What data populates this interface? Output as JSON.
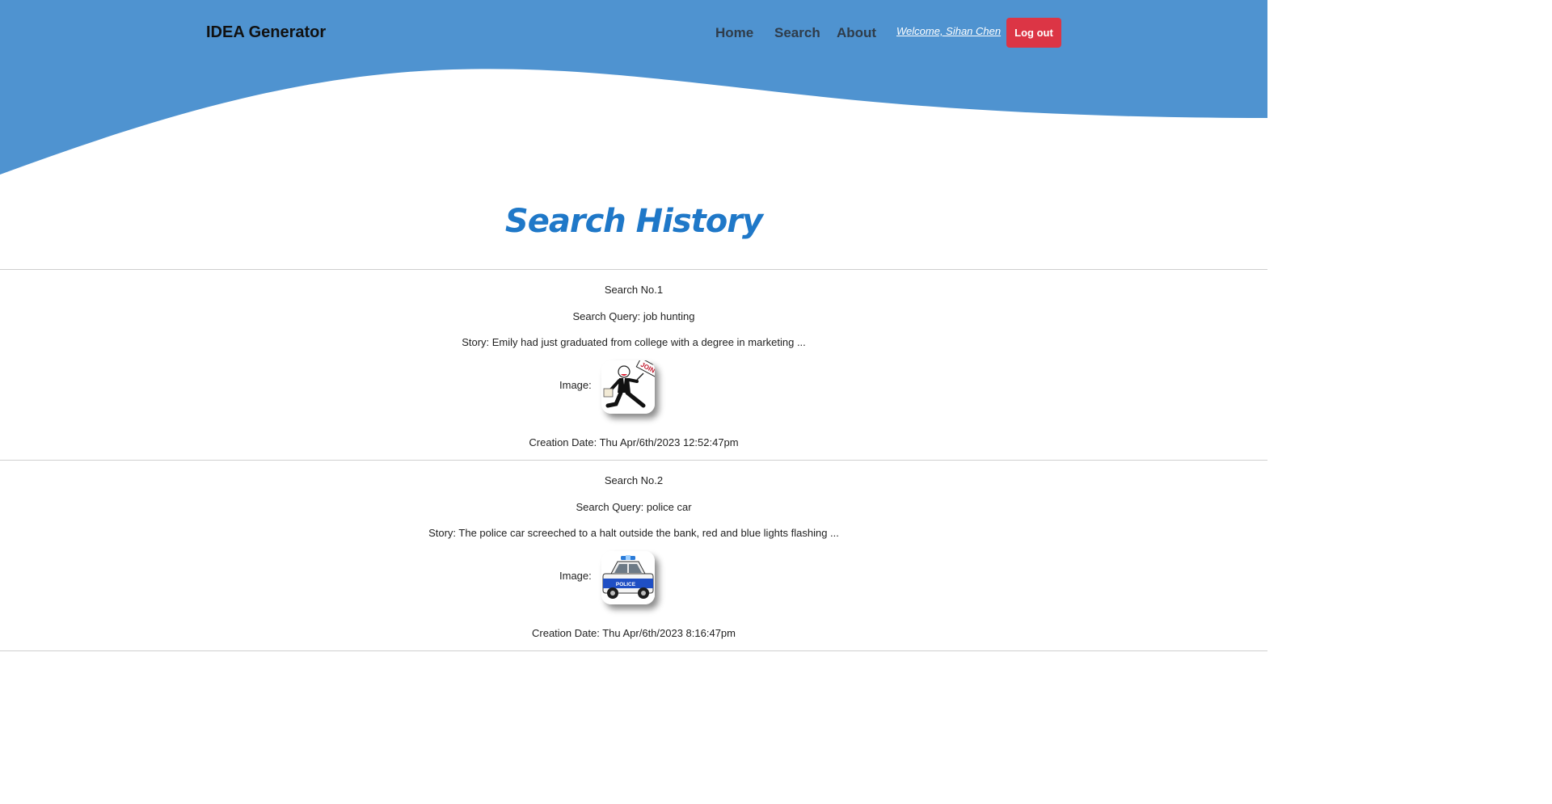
{
  "header": {
    "brand": "IDEA Generator",
    "nav": {
      "home": "Home",
      "search": "Search",
      "about": "About"
    },
    "welcome": "Welcome, Sihan Chen",
    "logout_label": "Log out",
    "colors": {
      "header_bg": "#4f93d0",
      "logout_bg": "#dc3545"
    }
  },
  "main": {
    "title": "Search History",
    "title_color": "#1f78c8",
    "searches": [
      {
        "number_text": "Search No.1",
        "query_text": "Search Query: job hunting",
        "story_text": "Story: Emily had just graduated from college with a degree in marketing ...",
        "image_label": "Image:",
        "image_icon": "job-hunter-icon",
        "image_sign_text": "JOIN",
        "date_text": "Creation Date: Thu Apr/6th/2023 12:52:47pm"
      },
      {
        "number_text": "Search No.2",
        "query_text": "Search Query: police car",
        "story_text": "Story: The police car screeched to a halt outside the bank, red and blue lights flashing ...",
        "image_label": "Image:",
        "image_icon": "police-car-icon",
        "image_sign_text": "POLICE",
        "date_text": "Creation Date: Thu Apr/6th/2023 8:16:47pm"
      }
    ]
  }
}
